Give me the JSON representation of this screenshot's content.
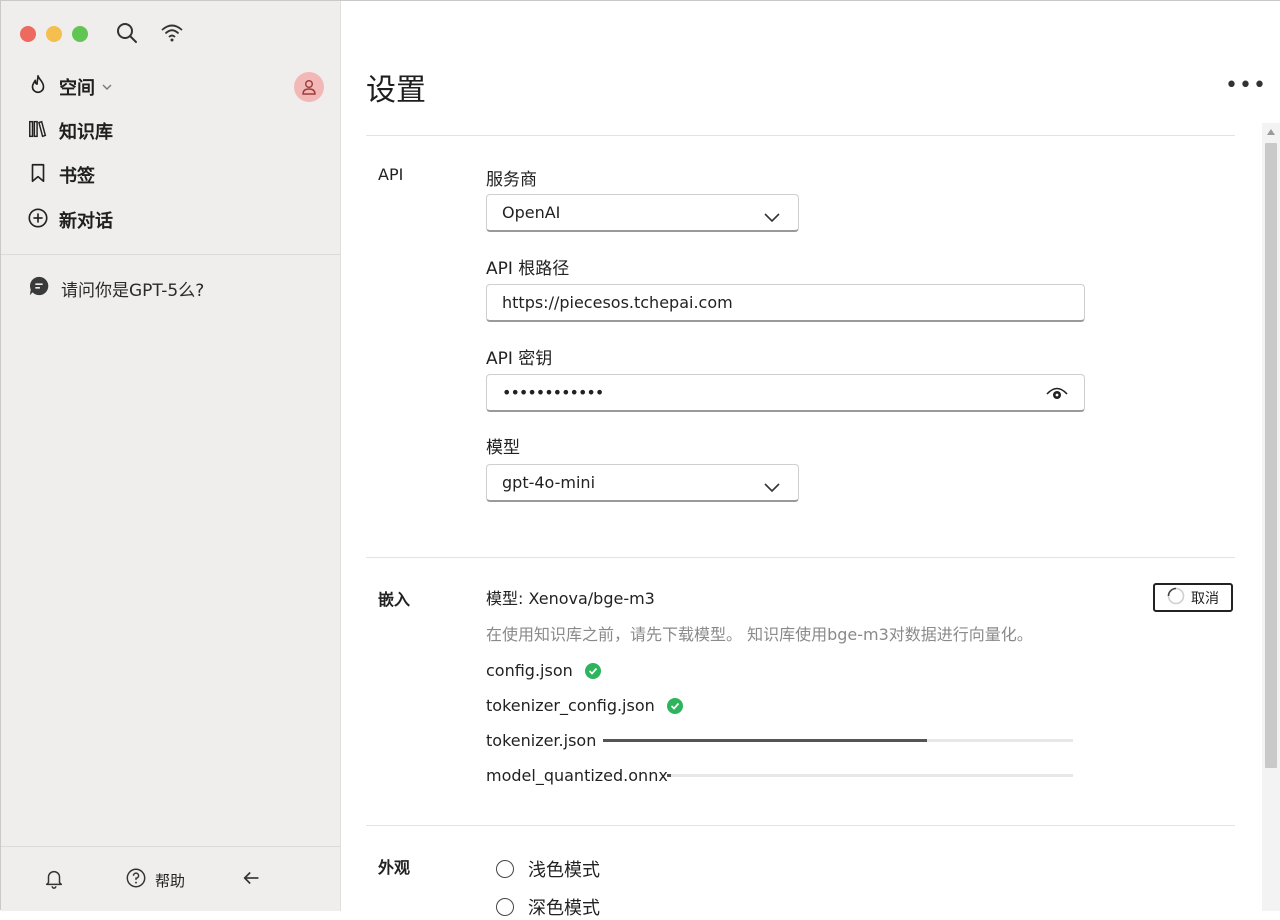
{
  "sidebar": {
    "nav": [
      {
        "label": "空间",
        "icon": "flame-icon"
      },
      {
        "label": "知识库",
        "icon": "books-icon"
      },
      {
        "label": "书签",
        "icon": "bookmark-icon"
      },
      {
        "label": "新对话",
        "icon": "plus-circle-icon"
      }
    ],
    "chats": [
      {
        "label": "请问你是GPT-5么?"
      }
    ],
    "bottom": {
      "help_label": "帮助"
    }
  },
  "main": {
    "title": "设置",
    "api": {
      "section_label": "API",
      "provider_label": "服务商",
      "provider_value": "OpenAI",
      "base_url_label": "API 根路径",
      "base_url_value": "https://piecesos.tchepai.com",
      "key_label": "API 密钥",
      "key_value": "••••••••••••",
      "model_label": "模型",
      "model_value": "gpt-4o-mini"
    },
    "embedding": {
      "section_label": "嵌入",
      "model_text": "模型:  Xenova/bge-m3",
      "description": "在使用知识库之前，请先下载模型。 知识库使用bge-m3对数据进行向量化。",
      "cancel_label": "取消",
      "files": [
        {
          "name": "config.json",
          "status": "done"
        },
        {
          "name": "tokenizer_config.json",
          "status": "done"
        },
        {
          "name": "tokenizer.json",
          "status": "downloading",
          "progress": 0.69
        },
        {
          "name": "model_quantized.onnx",
          "status": "downloading",
          "progress": 0.01
        }
      ]
    },
    "appearance": {
      "section_label": "外观",
      "options": [
        "浅色模式",
        "深色模式"
      ]
    }
  },
  "colors": {
    "sidebar_bg": "#efeeec",
    "success": "#2db55d",
    "avatar_bg": "#f2b8b8"
  }
}
